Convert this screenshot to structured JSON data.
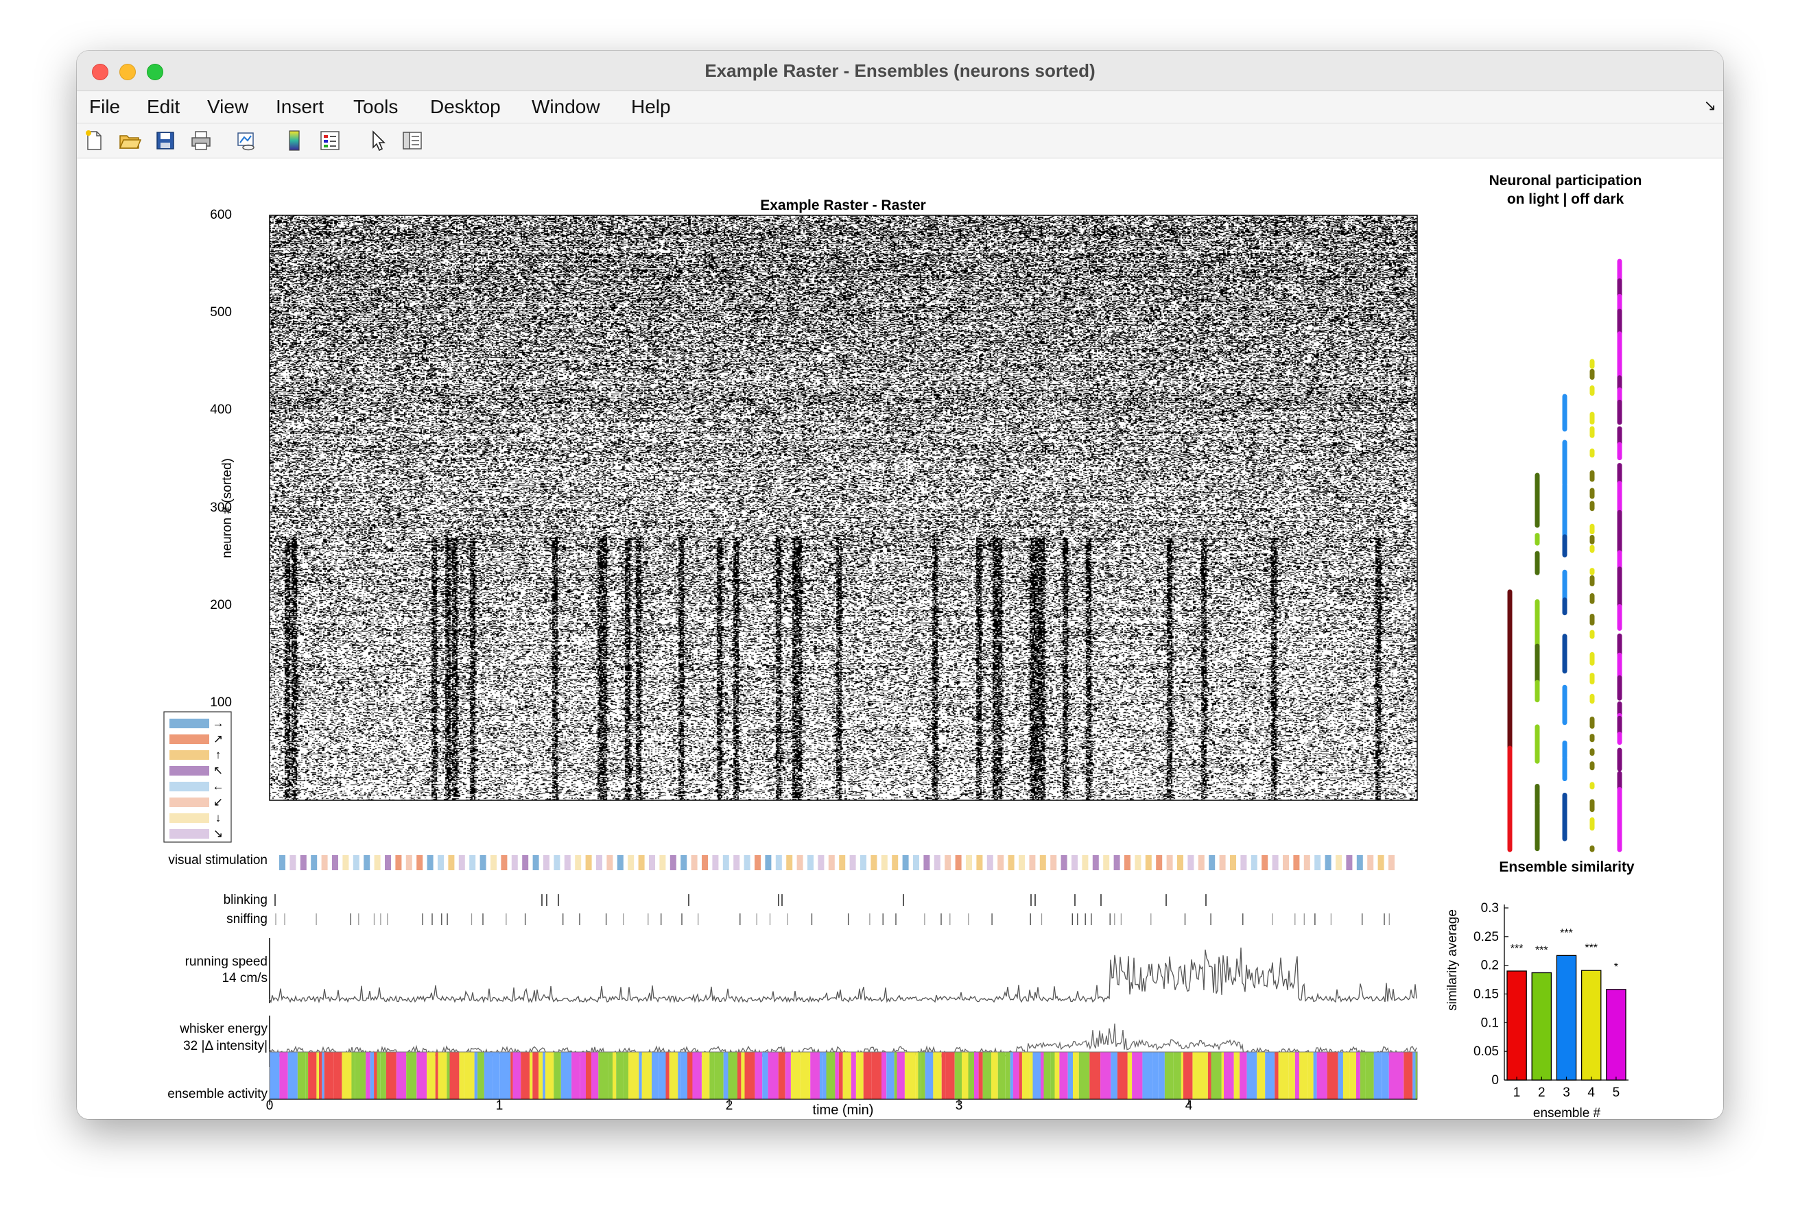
{
  "window": {
    "title": "Example Raster - Ensembles (neurons sorted)"
  },
  "menu": [
    "File",
    "Edit",
    "View",
    "Insert",
    "Tools",
    "Desktop",
    "Window",
    "Help"
  ],
  "toolbar": [
    "new-figure-icon",
    "open-file-icon",
    "save-icon",
    "print-icon",
    "link-plot-icon",
    "insert-colorbar-icon",
    "insert-legend-icon",
    "edit-plot-icon",
    "open-property-inspector-icon"
  ],
  "figure": {
    "raster": {
      "title": "Example Raster - Raster",
      "ylabel": "neuron # (sorted)",
      "yticks": [
        "600",
        "500",
        "400",
        "300",
        "200",
        "100"
      ]
    },
    "direction_legend": [
      "→",
      "↗",
      "↑",
      "↖",
      "←",
      "↙",
      "↓",
      "↘"
    ],
    "direction_colors": [
      "#7fb1d9",
      "#ee9a78",
      "#f3cd86",
      "#b28bc2",
      "#bcd9ef",
      "#f5cbb7",
      "#f8e7b8",
      "#dcc9e4"
    ],
    "rows": {
      "visual": "visual stimulation",
      "blinking": "blinking",
      "sniffing": "sniffing",
      "running_1": "running speed",
      "running_2": "14 cm/s",
      "whisker_1": "whisker energy",
      "whisker_2": "32 |Δ intensity|",
      "ensemble": "ensemble activity"
    },
    "time_axis": {
      "ticks": [
        "0",
        "1",
        "2",
        "3",
        "4"
      ],
      "label": "time (min)"
    },
    "ensemble_colors": [
      "#ef4b4b",
      "#8fce3f",
      "#6aa6ff",
      "#f1ea3d",
      "#e84fe0"
    ],
    "participation": {
      "title_1": "Neuronal participation",
      "title_2": "on light | off dark",
      "light_colors": [
        "#e8131b",
        "#8ed11f",
        "#2690f2",
        "#e6e61d",
        "#e51ff0"
      ],
      "dark_colors": [
        "#6a0c10",
        "#4b6e0e",
        "#0e4aa0",
        "#7b7a10",
        "#7d0c7c"
      ]
    }
  },
  "chart_data": [
    {
      "type": "bar",
      "title": "Ensemble similarity",
      "xlabel": "ensemble #",
      "ylabel": "similarity average",
      "categories": [
        "1",
        "2",
        "3",
        "4",
        "5"
      ],
      "values": [
        0.19,
        0.187,
        0.217,
        0.191,
        0.158
      ],
      "significance": [
        "***",
        "***",
        "***",
        "***",
        "*"
      ],
      "colors": [
        "#ec0606",
        "#77c710",
        "#0d7ff2",
        "#e6e20e",
        "#dd08dd"
      ],
      "ylim": [
        0,
        0.3
      ],
      "yticks": [
        "0",
        "0.05",
        "0.1",
        "0.15",
        "0.2",
        "0.25",
        "0.3"
      ]
    }
  ]
}
